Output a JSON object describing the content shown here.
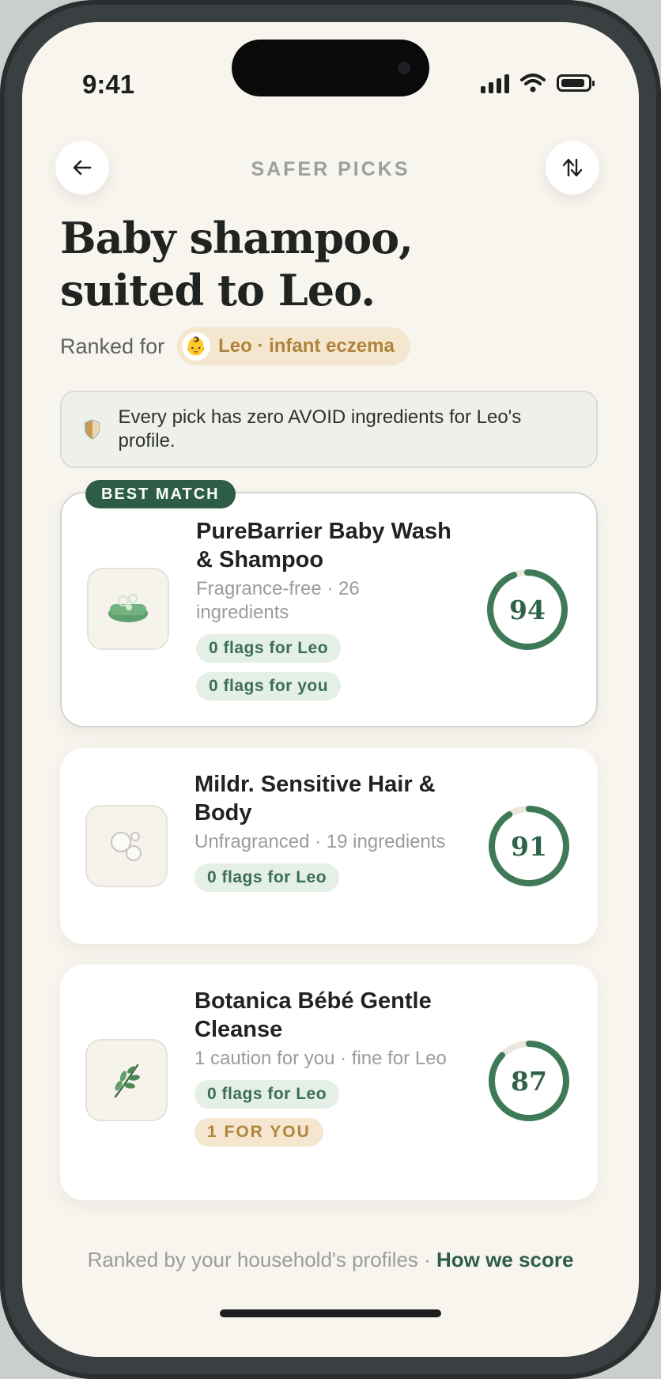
{
  "status": {
    "time": "9:41"
  },
  "header": {
    "label": "SAFER PICKS"
  },
  "title": {
    "line1": "Baby shampoo,",
    "line2": "suited to Leo."
  },
  "ranked": {
    "label": "Ranked for",
    "chip": "Leo · infant eczema",
    "chip_emoji": "👶"
  },
  "notice": {
    "text": "Every pick has zero AVOID ingredients for Leo's profile."
  },
  "best_badge": "BEST MATCH",
  "products": [
    {
      "name": "PureBarrier Baby Wash & Shampoo",
      "meta": "Fragrance-free · 26 ingredients",
      "tags": [
        {
          "label": "0 flags for Leo",
          "style": "green"
        },
        {
          "label": "0 flags for you",
          "style": "green"
        }
      ],
      "score": 94,
      "icon": "soap-bar-icon"
    },
    {
      "name": "Mildr. Sensitive Hair & Body",
      "meta": "Unfragranced · 19 ingredients",
      "tags": [
        {
          "label": "0 flags for Leo",
          "style": "green"
        }
      ],
      "score": 91,
      "icon": "bubbles-icon"
    },
    {
      "name": "Botanica Bébé Gentle Cleanse",
      "meta": "1 caution for you · fine for Leo",
      "tags": [
        {
          "label": "0 flags for Leo",
          "style": "green"
        },
        {
          "label": "1 FOR YOU",
          "style": "gold"
        }
      ],
      "score": 87,
      "icon": "leaf-icon"
    }
  ],
  "footer": {
    "text": "Ranked by your household's profiles · ",
    "link": "How we score"
  },
  "colors": {
    "accent": "#2e5d47",
    "ring": "#3f7a58",
    "ring_track": "#ece7dc",
    "gold": "#b0843b"
  }
}
